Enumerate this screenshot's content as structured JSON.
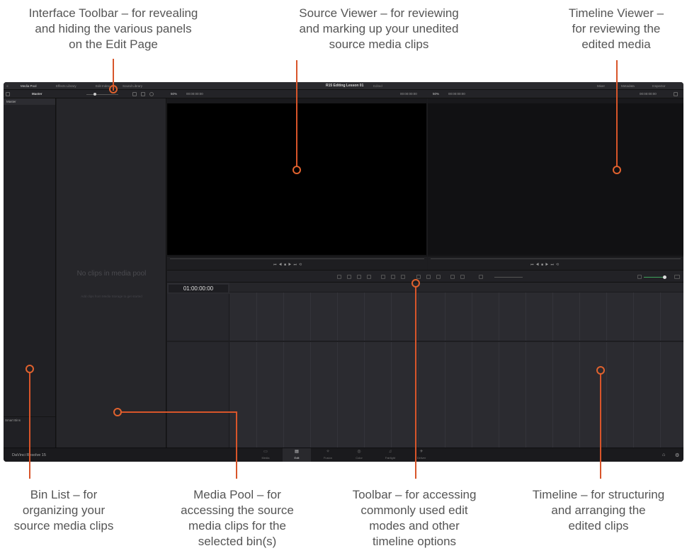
{
  "callouts": {
    "interface_toolbar": [
      "Interface Toolbar – for revealing",
      "and hiding the various panels",
      "on the Edit Page"
    ],
    "source_viewer": [
      "Source Viewer – for reviewing",
      "and marking up your unedited",
      "source media clips"
    ],
    "timeline_viewer": [
      "Timeline Viewer –",
      "for reviewing the",
      "edited media"
    ],
    "bin_list": [
      "Bin List – for",
      "organizing your",
      "source media clips"
    ],
    "media_pool": [
      "Media Pool – for",
      "accessing the source",
      "media clips for the",
      "selected bin(s)"
    ],
    "toolbar": [
      "Toolbar – for accessing",
      "commonly used edit",
      "modes and other",
      "timeline options"
    ],
    "timeline": [
      "Timeline – for structuring",
      "and arranging the",
      "edited clips"
    ]
  },
  "app": {
    "interface_toolbar": {
      "buttons": [
        "Media Pool",
        "Effects Library",
        "Edit Index",
        "Sound Library"
      ],
      "project_title": "R15 Editing Lesson 01",
      "project_status": "Edited",
      "right_buttons": [
        "Mixer",
        "Metadata",
        "Inspector"
      ]
    },
    "secondary_toolbar": {
      "bin_name": "Master",
      "source_zoom": "50%",
      "source_timecode": "00:00:00:00",
      "source_duration": "00:00:00:00",
      "timeline_zoom": "50%",
      "timeline_timecode": "00:00:00:00",
      "timeline_duration": "00:00:00:00"
    },
    "bin_list": {
      "master": "Master",
      "smart_bins": "Smart Bins"
    },
    "media_pool": {
      "empty_text": "No clips in media pool",
      "hint_text": "Add clips from Media Storage to get started"
    },
    "timeline": {
      "timecode": "01:00:00:00"
    },
    "page_nav": {
      "brand": "DaVinci Resolve 15",
      "pages": [
        "Media",
        "Edit",
        "Fusion",
        "Color",
        "Fairlight",
        "Deliver"
      ],
      "active": "Edit"
    }
  },
  "colors": {
    "accent_orange": "#e0622e",
    "volume_green": "#3ea35c"
  }
}
